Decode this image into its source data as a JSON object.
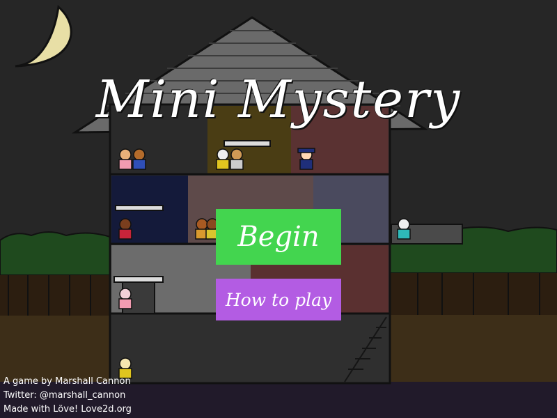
{
  "game": {
    "title": "Mini Mystery"
  },
  "menu": {
    "begin_label": "Begin",
    "how_to_play_label": "How to play"
  },
  "credits": {
    "line1": "A game by Marshall Cannon",
    "line2": "Twitter: @marshall_cannon",
    "line3": "Made with Löve! Love2d.org"
  },
  "colors": {
    "begin_button": "#43d54f",
    "how_to_play_button": "#b35ce3",
    "sky": "#262626",
    "moon": "#e8dfa6"
  },
  "icons": {
    "moon": "crescent-moon-icon"
  }
}
